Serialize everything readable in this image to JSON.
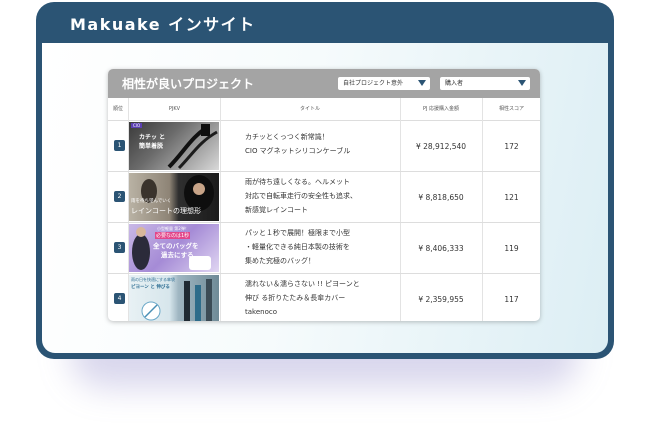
{
  "window": {
    "title": "Makuake インサイト"
  },
  "panel": {
    "title": "相性が良いプロジェクト",
    "filters": [
      {
        "label": "自社プロジェクト意外"
      },
      {
        "label": "購入者"
      }
    ],
    "columns": [
      "順位",
      "PJKV",
      "タイトル",
      "PJ 応援購入金額",
      "相性スコア"
    ],
    "rows": [
      {
        "rank": "1",
        "title_lines": [
          "カチッとくっつく新常識！",
          "CIO マグネットシリコンケーブル"
        ],
        "amount": "¥ 28,912,540",
        "score": "172",
        "thumb_text": [
          "CIO",
          "カチッ と",
          "簡単着脱"
        ]
      },
      {
        "rank": "2",
        "title_lines": [
          "雨が待ち遠しくなる。ヘルメット",
          "対応で自転車走行の安全性も追求、",
          "新感覚レインコート"
        ],
        "amount": "¥ 8,818,650",
        "score": "121",
        "thumb_text": [
          "雨を待ち望んでいく",
          "レインコートの理想形"
        ]
      },
      {
        "rank": "3",
        "title_lines": [
          "パッと１秒で展開！極限まで小型",
          "・軽量化できる純日本製の技術を",
          "集めた究極のバッグ！"
        ],
        "amount": "¥ 8,406,333",
        "score": "119",
        "thumb_text": [
          "小型軽量 第2弾！",
          "必要なのは1秒",
          "全てのバッグを",
          "過去にする"
        ]
      },
      {
        "rank": "4",
        "title_lines": [
          "濡れない＆濡らさない !! ピヨーンと",
          "伸び る折りたたみ＆長傘カバー",
          "takenoco"
        ],
        "amount": "¥ 2,359,955",
        "score": "117",
        "thumb_text": [
          "雨の日を快適にする傘袋",
          "ピヨーン と 伸びる"
        ]
      }
    ]
  }
}
